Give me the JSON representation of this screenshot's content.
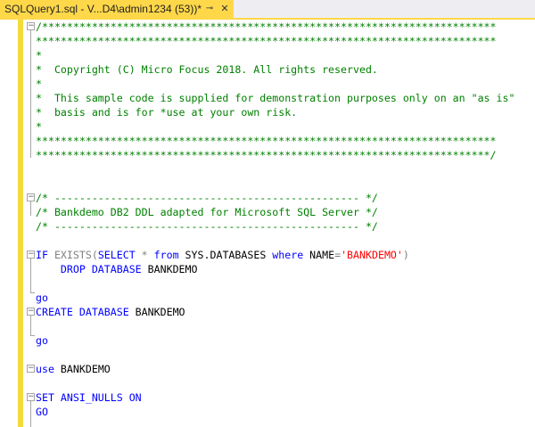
{
  "tab": {
    "title": "SQLQuery1.sql - V...D4\\admin1234 (53))*",
    "pin_icon": "⊸",
    "close_icon": "✕"
  },
  "code": {
    "l1": "/*************************************************************************",
    "l2": "**************************************************************************",
    "l3": "*",
    "l4": "*  Copyright (C) Micro Focus 2018. All rights reserved.",
    "l5": "*",
    "l6": "*  This sample code is supplied for demonstration purposes only on an \"as is\"",
    "l7": "*  basis and is for *use at your own risk.",
    "l8": "*",
    "l9": "**************************************************************************",
    "l10": "*************************************************************************/",
    "l12": "/* ------------------------------------------------- */",
    "l13": "/* Bankdemo DB2 DDL adapted for Microsoft SQL Server */",
    "l14": "/* ------------------------------------------------- */",
    "l17_if": "IF",
    "l17_exists": " EXISTS(",
    "l17_select": "SELECT",
    "l17_star": " * ",
    "l17_from": "from",
    "l17_sys": " SYS.DATABASES ",
    "l17_where": "where",
    "l17_name": " NAME",
    "l17_eq": "=",
    "l17_str": "'BANKDEMO'",
    "l17_close": ")",
    "l18_indent": "    ",
    "l18_drop": "DROP DATABASE",
    "l18_name": " BANKDEMO",
    "l20_go": "go",
    "l21_create": "CREATE DATABASE",
    "l21_name": " BANKDEMO",
    "l23_go": "go",
    "l25_use": "use",
    "l25_name": " BANKDEMO",
    "l27_set": "SET ANSI_NULLS ON",
    "l28_go": "GO"
  }
}
